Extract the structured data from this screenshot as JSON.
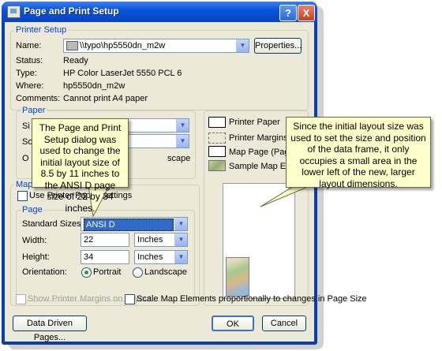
{
  "dialog": {
    "title": "Page and Print Setup",
    "help_glyph": "?",
    "close_glyph": "X"
  },
  "printer_setup": {
    "legend": "Printer Setup",
    "name_label": "Name:",
    "name_value": "\\\\typo\\hp5550dn_m2w",
    "properties_button": "Properties...",
    "status_label": "Status:",
    "status_value": "Ready",
    "type_label": "Type:",
    "type_value": "HP Color LaserJet 5550 PCL 6",
    "where_label": "Where:",
    "where_value": "hp5550dn_m2w",
    "comments_label": "Comments:",
    "comments_value": "Cannot print A4 paper"
  },
  "paper": {
    "legend": "Paper",
    "size_label_partial": "Si",
    "source_label_partial": "So",
    "orientation_label_partial": "O",
    "landscape_partial": "scape"
  },
  "map_page": {
    "legend_partial": "Map",
    "use_printer_settings": "Use Printer Paper Settings",
    "page_legend": "Page",
    "standard_sizes_label": "Standard Sizes:",
    "standard_sizes_value": "ANSI D",
    "width_label": "Width:",
    "width_value": "22",
    "width_units": "Inches",
    "height_label": "Height:",
    "height_value": "34",
    "height_units": "Inches",
    "orientation_label": "Orientation:",
    "portrait_label": "Portrait",
    "landscape_label": "Landscape",
    "portrait_selected": true
  },
  "preview_legend": {
    "printer_paper": "Printer Paper",
    "printer_margins": "Printer Margins",
    "map_page": "Map Page (Page La",
    "sample_map": "Sample Map Eleme"
  },
  "bottom": {
    "show_margins": "Show Printer Margins on Layout",
    "scale_elements": "Scale Map Elements proportionally to changes in Page Size",
    "data_driven_button": "Data Driven Pages...",
    "ok_button": "OK",
    "cancel_button": "Cancel"
  },
  "callouts": {
    "left": "The Page and Print Setup dialog was used to change the initial layout size of 8.5 by 11 inches to the ANSI D page size of 22 by 34 inches.",
    "right": "Since the initial layout size was used to set the size and position of the data frame, it only occupies a small area in the lower left of the new, larger layout dimensions."
  },
  "colors": {
    "titlebar": "#0a54d8",
    "group_label": "#0046d5",
    "callout_fill": "#ffffcc",
    "selected_field": "#316ac5"
  }
}
